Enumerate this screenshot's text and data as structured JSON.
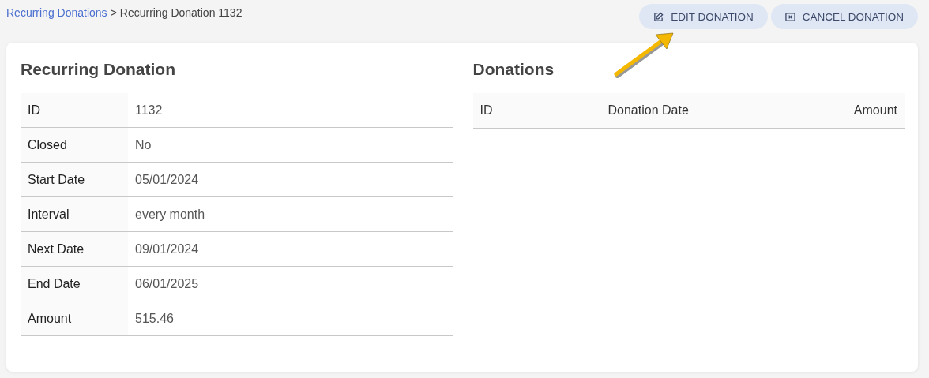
{
  "breadcrumb": {
    "link": "Recurring Donations",
    "separator": ">",
    "current": "Recurring Donation 1132"
  },
  "actions": [
    {
      "kind": "edit",
      "label": "EDIT DONATION"
    },
    {
      "kind": "cancel",
      "label": "CANCEL DONATION"
    }
  ],
  "details": {
    "title": "Recurring Donation",
    "rows": [
      {
        "label": "ID",
        "value": "1132"
      },
      {
        "label": "Closed",
        "value": "No"
      },
      {
        "label": "Start Date",
        "value": "05/01/2024"
      },
      {
        "label": "Interval",
        "value": "every month"
      },
      {
        "label": "Next Date",
        "value": "09/01/2024"
      },
      {
        "label": "End Date",
        "value": "06/01/2025"
      },
      {
        "label": "Amount",
        "value": "515.46"
      }
    ]
  },
  "donations": {
    "title": "Donations",
    "columns": [
      "ID",
      "Donation Date",
      "Amount"
    ]
  }
}
